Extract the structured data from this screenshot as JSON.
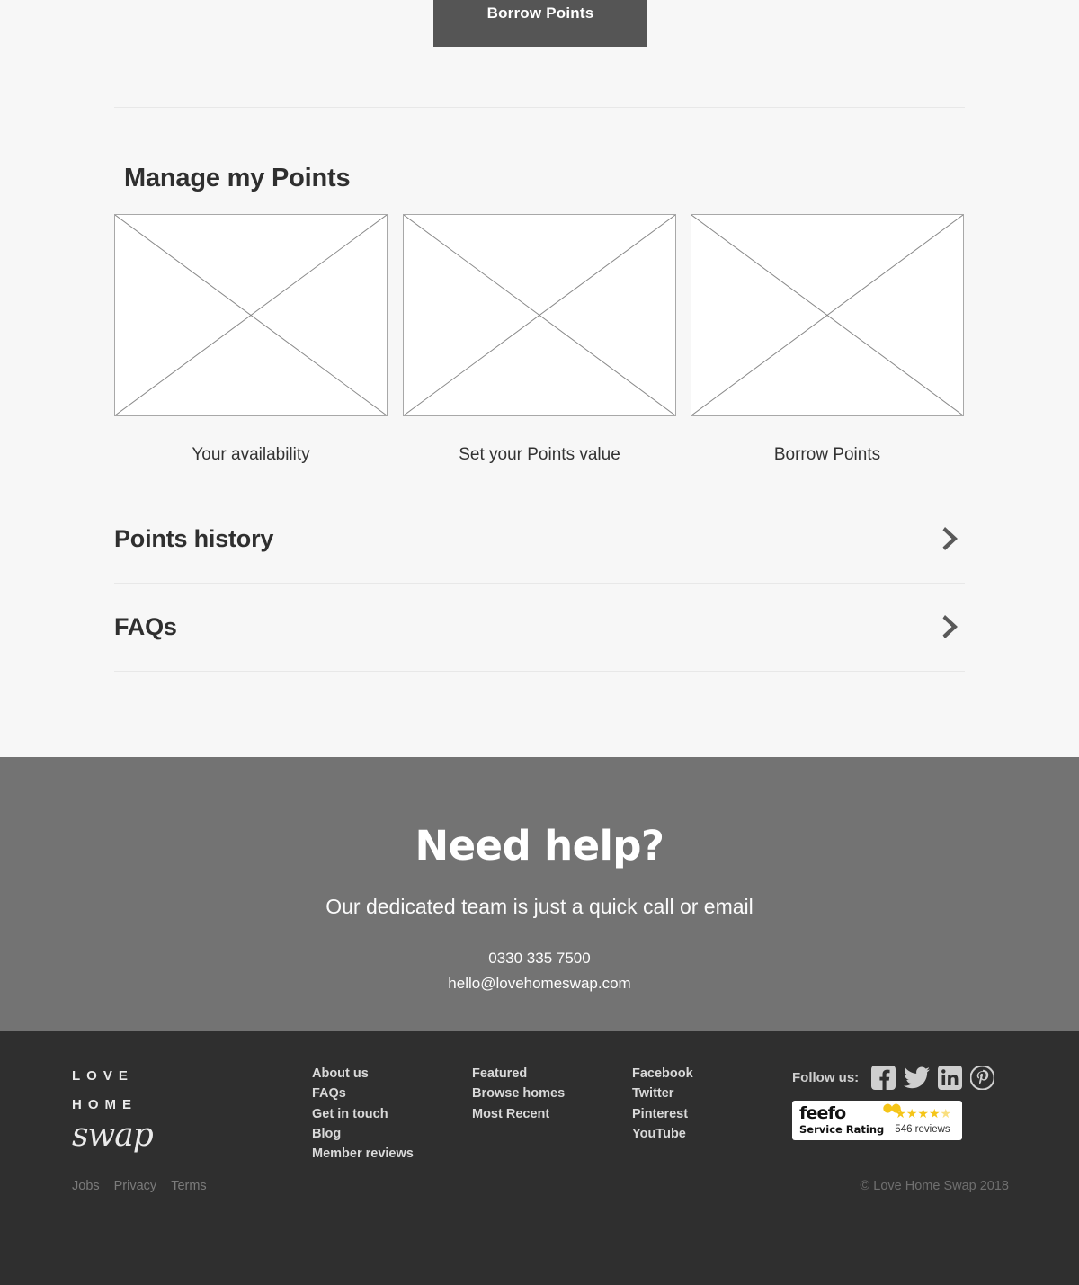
{
  "top": {
    "borrow_button_label": "Borrow Points",
    "button_color": "#555555"
  },
  "main": {
    "section_title": "Manage my Points",
    "tiles": [
      {
        "caption": "Your availability",
        "image": "broken-image-placeholder"
      },
      {
        "caption": "Set your Points value",
        "image": "broken-image-placeholder"
      },
      {
        "caption": "Borrow Points",
        "image": "broken-image-placeholder"
      }
    ],
    "rows": [
      {
        "label": "Points history",
        "chevron": "chevron-right-icon"
      },
      {
        "label": "FAQs",
        "chevron": "chevron-right-icon"
      }
    ],
    "background_color": "#f7f7f7",
    "rule_color": "#e8e8e8"
  },
  "help": {
    "title": "Need help?",
    "subtitle": "Our dedicated team is just a quick call or email",
    "phone": "0330 335 7500",
    "email": "hello@lovehomeswap.com",
    "background_color": "#737373"
  },
  "footer": {
    "background_color": "#2f2f2f",
    "logo": {
      "line1": "LOVE",
      "line2": "HOME",
      "script": "swap"
    },
    "columns": [
      {
        "links": [
          "About us",
          "FAQs",
          "Get in touch",
          "Blog",
          "Member reviews"
        ]
      },
      {
        "links": [
          "Featured",
          "Browse homes",
          "Most Recent"
        ]
      },
      {
        "links": [
          "Facebook",
          "Twitter",
          "Pinterest",
          "YouTube"
        ]
      }
    ],
    "follow": {
      "label": "Follow us:",
      "icons": [
        "facebook-icon",
        "twitter-icon",
        "linkedin-icon",
        "pinterest-icon"
      ]
    },
    "feefo": {
      "brand": "feefo",
      "service_rating": "Service Rating",
      "stars": "★★★★",
      "half_star": "★",
      "rating_value": 4.5,
      "reviews": "546 reviews",
      "star_color": "#f5c518"
    },
    "legal": {
      "links": [
        "Jobs",
        "Privacy",
        "Terms"
      ],
      "copyright": "© Love Home Swap 2018"
    }
  }
}
